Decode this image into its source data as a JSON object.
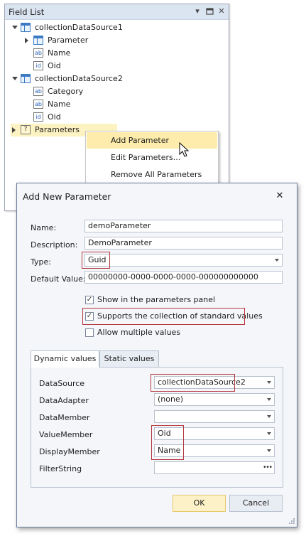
{
  "field_list": {
    "title": "Field List",
    "tree": [
      {
        "label": "collectionDataSource1",
        "icon": "table-icon",
        "expanded": true
      },
      {
        "label": "Parameter",
        "icon": "table-icon",
        "expanded": false
      },
      {
        "label": "Name",
        "icon": "text-field-icon"
      },
      {
        "label": "Oid",
        "icon": "id-field-icon"
      },
      {
        "label": "collectionDataSource2",
        "icon": "table-icon",
        "expanded": true
      },
      {
        "label": "Category",
        "icon": "text-field-icon"
      },
      {
        "label": "Name",
        "icon": "text-field-icon"
      },
      {
        "label": "Oid",
        "icon": "id-field-icon"
      },
      {
        "label": "Parameters",
        "icon": "parameters-icon",
        "expanded": false
      }
    ],
    "icon_text": {
      "text": "ab",
      "id": "id",
      "param": "?"
    }
  },
  "context_menu": {
    "items": [
      "Add Parameter",
      "Edit Parameters...",
      "Remove All Parameters"
    ],
    "selected": "Add Parameter"
  },
  "dialog": {
    "title": "Add New Parameter",
    "close_glyph": "✕",
    "labels": {
      "name": "Name:",
      "description": "Description:",
      "type": "Type:",
      "default_value": "Default Value:"
    },
    "values": {
      "name": "demoParameter",
      "description": "DemoParameter",
      "type": "Guid",
      "default_value": "00000000-0000-0000-0000-000000000000"
    },
    "checkboxes": [
      {
        "label": "Show in the parameters panel",
        "checked": true
      },
      {
        "label": "Supports the collection of standard values",
        "checked": true
      },
      {
        "label": "Allow multiple values",
        "checked": false
      }
    ],
    "check_glyph": "✓",
    "tabs": [
      "Dynamic values",
      "Static values"
    ],
    "active_tab": "Dynamic values",
    "dynamic": {
      "labels": [
        "DataSource",
        "DataAdapter",
        "DataMember",
        "ValueMember",
        "DisplayMember",
        "FilterString"
      ],
      "values": [
        "collectionDataSource2",
        "(none)",
        "",
        "Oid",
        "Name",
        ""
      ],
      "ellipsis": "•••"
    },
    "buttons": {
      "ok": "OK",
      "cancel": "Cancel"
    }
  },
  "colors": {
    "accent_highlight": "#fdecab",
    "callout_red": "#b5383f",
    "title_bar": "#dbe4f1"
  }
}
